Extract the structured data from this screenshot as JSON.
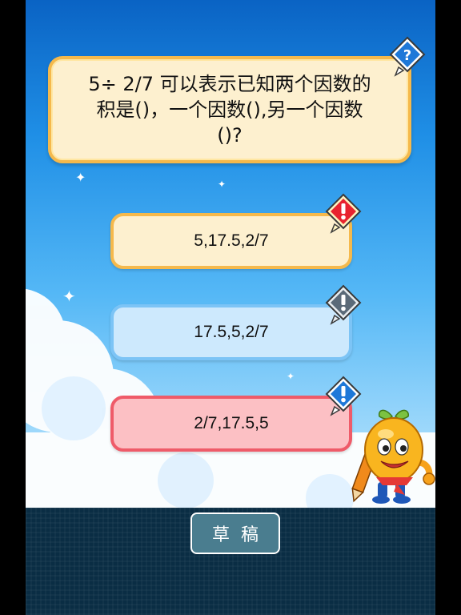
{
  "question": {
    "lines": [
      "5÷ 2/7 可以表示已知两个因数的",
      "积是()，一个因数(),另一个因数",
      "()?"
    ]
  },
  "answers": [
    {
      "label": "5,17.5,2/7",
      "badge_icon": "exclamation-icon",
      "badge_color": "#e8232f"
    },
    {
      "label": "17.5,5,2/7",
      "badge_icon": "exclamation-icon",
      "badge_color": "#5b6a78"
    },
    {
      "label": "2/7,17.5,5",
      "badge_icon": "exclamation-icon",
      "badge_color": "#1e78d8"
    }
  ],
  "help_badge": {
    "icon": "question-mark-icon",
    "color": "#1e78d8"
  },
  "toolbar": {
    "draft_label": "草稿"
  },
  "colors": {
    "question_border": "#f5b94c",
    "answer_a_border": "#f5b94c",
    "answer_b_border": "#7cc4f6",
    "answer_c_border": "#ef5b69",
    "bottom_bar": "#0a2d44"
  }
}
